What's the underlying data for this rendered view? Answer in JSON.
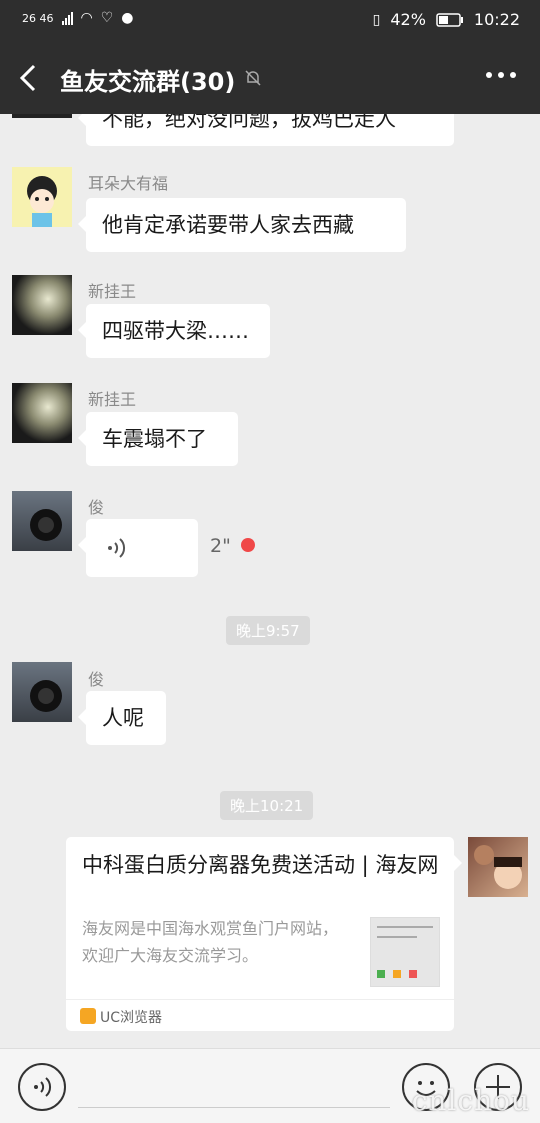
{
  "status": {
    "left": "26 46",
    "battery": "42%",
    "time": "10:22"
  },
  "header": {
    "title": "鱼友交流群(30)"
  },
  "messages": [
    {
      "text": "不能，绝对没问题，拔鸡巴走人"
    },
    {
      "sender": "耳朵大有福",
      "text": "他肯定承诺要带人家去西藏"
    },
    {
      "sender": "新挂王",
      "text": "四驱带大梁……"
    },
    {
      "sender": "新挂王",
      "text": "车震塌不了"
    },
    {
      "sender": "俊",
      "duration": "2\""
    },
    {
      "sender": "俊",
      "text": "人呢"
    }
  ],
  "timestamps": [
    "晚上9:57",
    "晚上10:21"
  ],
  "link_card": {
    "title": "中科蛋白质分离器免费送活动 | 海友网",
    "desc": "海友网是中国海水观赏鱼门户网站，欢迎广大海友交流学习。",
    "source": "UC浏览器"
  },
  "watermark": "cnlchou",
  "colors": {
    "bar": "#2e2e2e",
    "bg": "#ededed",
    "unread": "#f04848",
    "uc": "#f5a623"
  }
}
